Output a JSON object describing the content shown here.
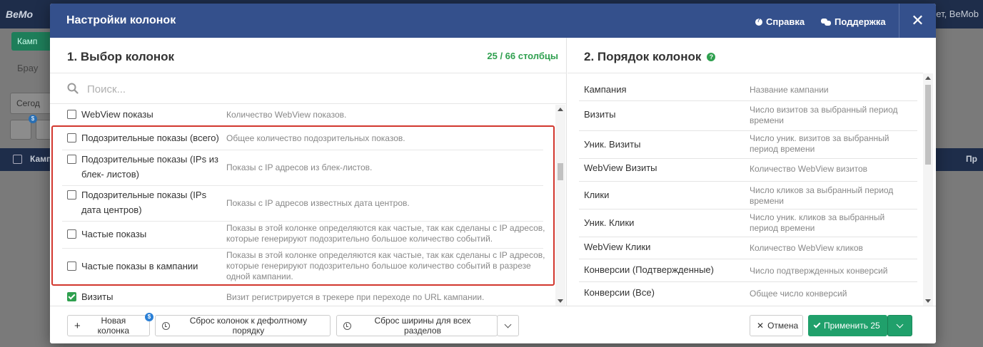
{
  "background": {
    "logo": "BeMo",
    "user": "ет, BeMob",
    "campaign_btn": "Камп",
    "browse": "Брау",
    "date": "Сегод",
    "badge": "$",
    "th_left": "Камп",
    "th_right": "Пр"
  },
  "modal": {
    "title": "Настройки колонок",
    "help_label": "Справка",
    "support_label": "Поддержка",
    "close_label": "✕"
  },
  "left": {
    "title": "1. Выбор колонок",
    "count": "25 / 66 столбцы",
    "search_placeholder": "Поиск...",
    "rows": [
      {
        "name": "WebView показы",
        "desc": "Количество WebView показов.",
        "checked": false
      },
      {
        "name": "Подозрительные показы (всего)",
        "desc": "Общее количество подозрительных показов.",
        "checked": false
      },
      {
        "name": "Подозрительные показы (IPs из блек- листов)",
        "desc": "Показы с IP адресов из блек-листов.",
        "checked": false
      },
      {
        "name": "Подозрительные показы (IPs дата центров)",
        "desc": "Показы с IP адресов известных дата центров.",
        "checked": false
      },
      {
        "name": "Частые показы",
        "desc": "Показы в этой колонке определяются как частые, так как сделаны с IP адресов, которые генерируют подозрительно большое количество событий.",
        "checked": false
      },
      {
        "name": "Частые показы в кампании",
        "desc": "Показы в этой колонке определяются как частые, так как сделаны с IP адресов, которые генерируют подозрительно большое количество событий в разрезе одной кампании.",
        "checked": false
      },
      {
        "name": "Визиты",
        "desc": "Визит регистрируется в трекере при переходе по URL кампании.",
        "checked": true
      }
    ]
  },
  "right": {
    "title": "2. Порядок колонок",
    "help_icon": "?",
    "rows": [
      {
        "name": "Кампания",
        "desc": "Название кампании"
      },
      {
        "name": "Визиты",
        "desc": "Число визитов за выбранный период времени"
      },
      {
        "name": "Уник. Визиты",
        "desc": "Число уник. визитов за выбранный период времени"
      },
      {
        "name": "WebView Визиты",
        "desc": "Количество WebView визитов"
      },
      {
        "name": "Клики",
        "desc": "Число кликов за выбранный период времени"
      },
      {
        "name": "Уник. Клики",
        "desc": "Число уник. кликов за выбранный период времени"
      },
      {
        "name": "WebView Клики",
        "desc": "Количество WebView кликов"
      },
      {
        "name": "Конверсии (Подтвержденные)",
        "desc": "Число подтвержденных конверсий"
      },
      {
        "name": "Конверсии (Все)",
        "desc": "Общее число конверсий"
      }
    ]
  },
  "footer": {
    "new_column": "Новая колонка",
    "new_column_badge": "$",
    "reset_order": "Сброс колонок к дефолтному порядку",
    "reset_width": "Сброс ширины для всех разделов",
    "cancel": "Отмена",
    "apply": "Применить 25"
  },
  "colors": {
    "header_bg": "#34508c",
    "accent_green": "#20a06b",
    "count_green": "#2fa04f",
    "highlight_red": "#d2372e"
  }
}
